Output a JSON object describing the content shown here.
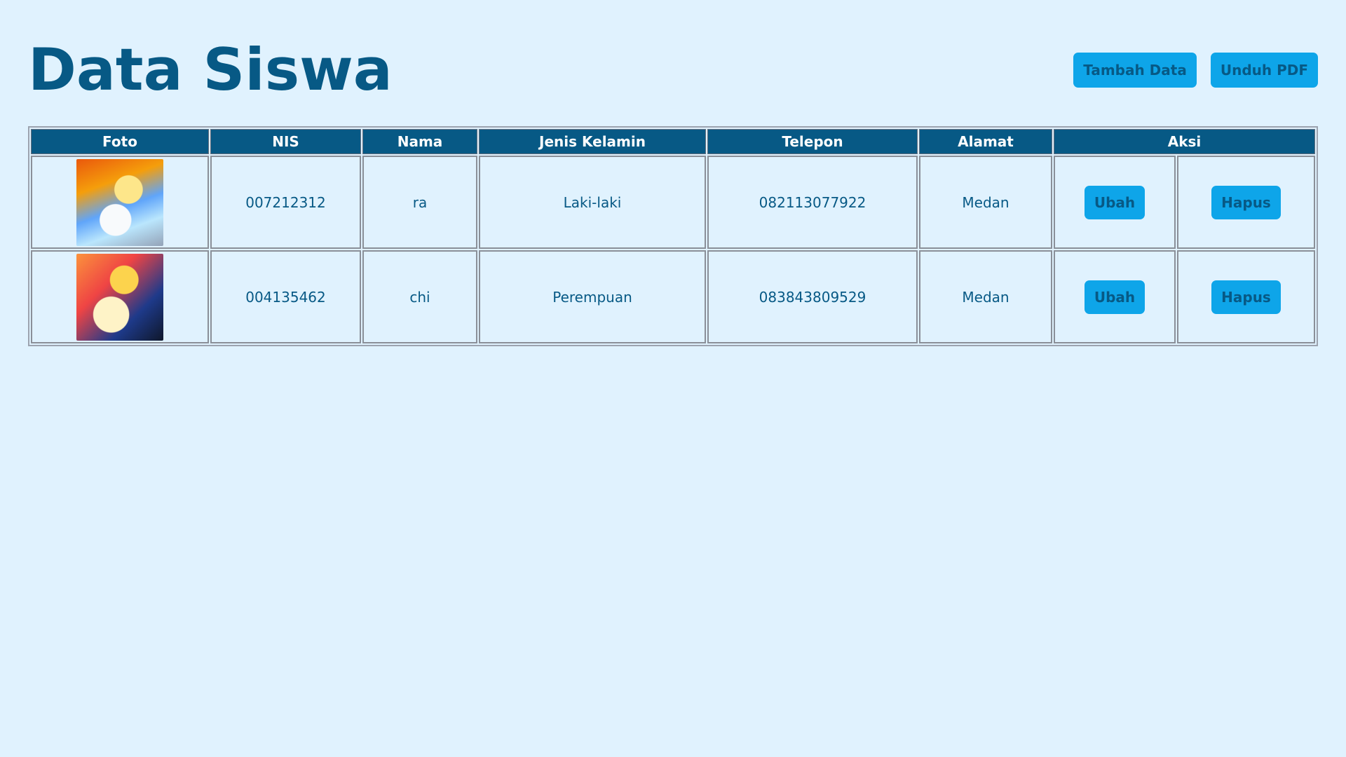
{
  "page": {
    "title": "Data Siswa"
  },
  "header_actions": {
    "add_label": "Tambah Data",
    "pdf_label": "Unduh PDF"
  },
  "table": {
    "columns": [
      "Foto",
      "NIS",
      "Nama",
      "Jenis Kelamin",
      "Telepon",
      "Alamat",
      "Aksi"
    ],
    "rows": [
      {
        "photo": "anime-portrait-1",
        "nis": "007212312",
        "nama": "ra",
        "jenis_kelamin": "Laki-laki",
        "telepon": "082113077922",
        "alamat": "Medan",
        "edit_label": "Ubah",
        "delete_label": "Hapus"
      },
      {
        "photo": "anime-portrait-2",
        "nis": "004135462",
        "nama": "chi",
        "jenis_kelamin": "Perempuan",
        "telepon": "083843809529",
        "alamat": "Medan",
        "edit_label": "Ubah",
        "delete_label": "Hapus"
      }
    ]
  },
  "colors": {
    "background": "#e0f2fe",
    "primary_text": "#075985",
    "header_bg": "#075985",
    "button_bg": "#0ea5e9"
  }
}
